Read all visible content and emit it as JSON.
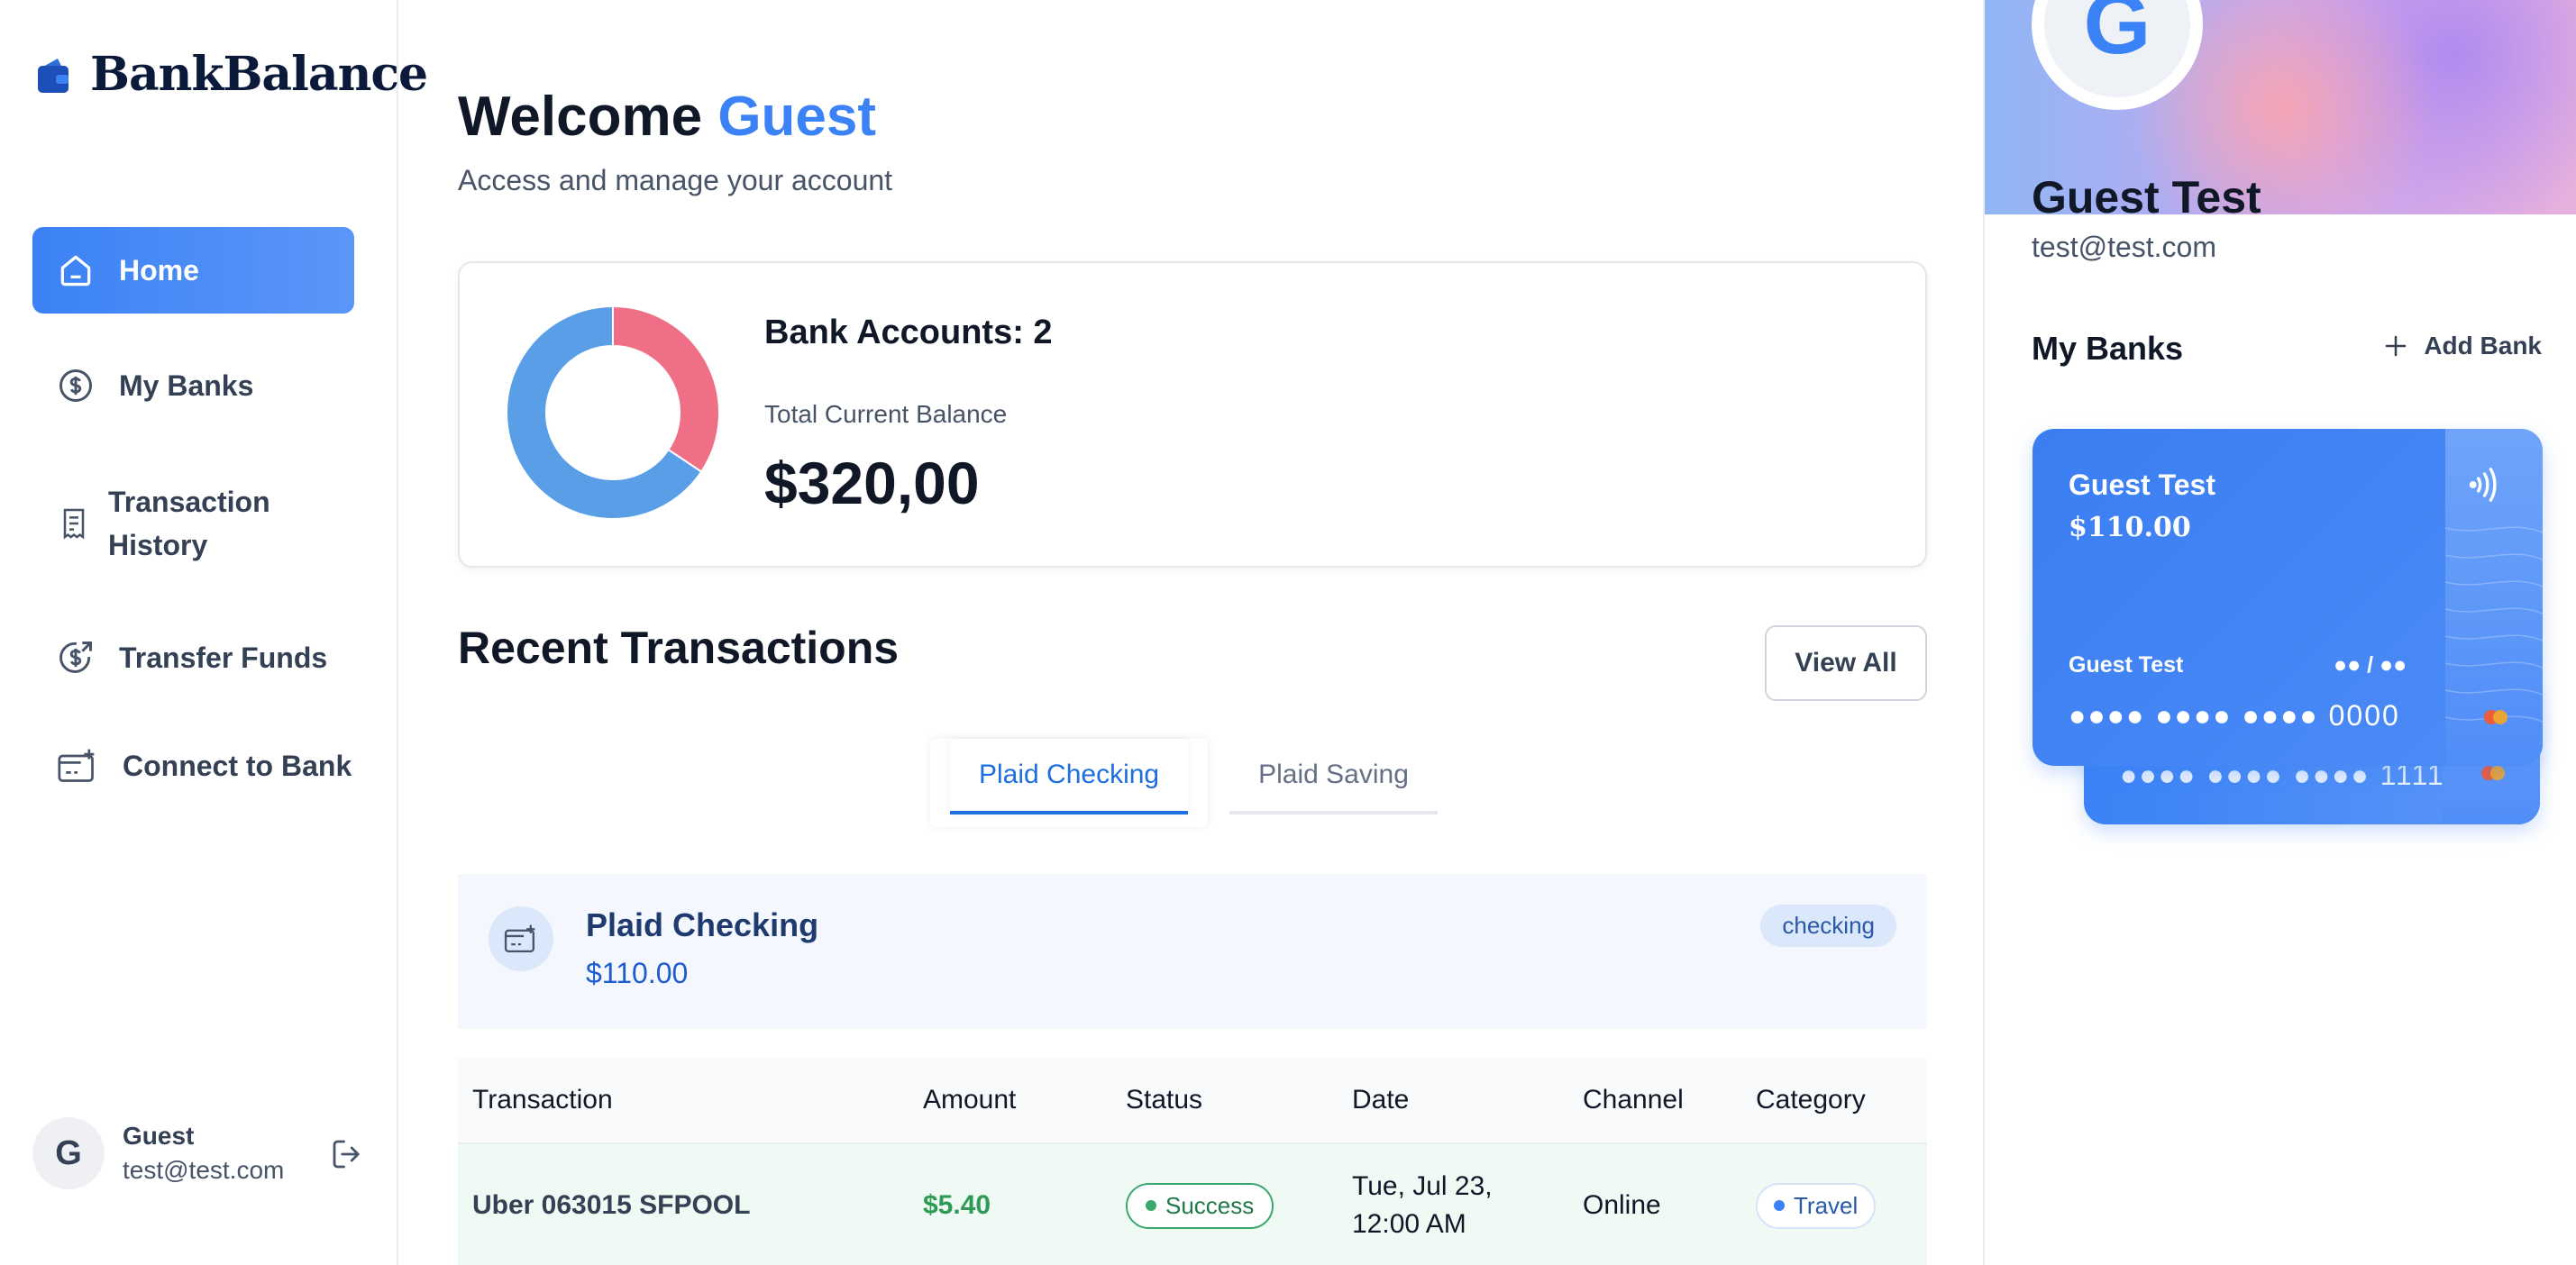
{
  "sidebar": {
    "logo_text": "BankBalance",
    "items": [
      {
        "label": "Home",
        "icon": "home-icon"
      },
      {
        "label": "My Banks",
        "icon": "dollar-circle-icon"
      },
      {
        "label": "Transaction",
        "label2": "History",
        "icon": "receipt-icon"
      },
      {
        "label": "Transfer Funds",
        "icon": "money-send-icon"
      },
      {
        "label": "Connect to Bank",
        "icon": "credit-card-add-icon"
      }
    ],
    "footer": {
      "initial": "G",
      "name": "Guest",
      "email": "test@test.com"
    }
  },
  "header": {
    "welcome_prefix": "Welcome",
    "welcome_name": "Guest",
    "subtitle": "Access and manage your account"
  },
  "summary": {
    "accounts_label": "Bank Accounts: 2",
    "balance_label": "Total Current Balance",
    "balance_value": "$320,00"
  },
  "chart_data": {
    "type": "pie",
    "values": [
      210,
      110
    ],
    "colors": [
      "#5a9ee8",
      "#ef6f86"
    ]
  },
  "recent": {
    "title": "Recent Transactions",
    "view_all": "View All",
    "tabs": [
      "Plaid Checking",
      "Plaid Saving"
    ],
    "active_tab": 0,
    "bank": {
      "name": "Plaid Checking",
      "balance": "$110.00",
      "type": "checking"
    },
    "columns": [
      "Transaction",
      "Amount",
      "Status",
      "Date",
      "Channel",
      "Category"
    ],
    "rows": [
      {
        "name": "Uber 063015 SFPOOL",
        "amount": "$5.40",
        "status": "Success",
        "date_line1": "Tue, Jul 23,",
        "date_line2": "12:00 AM",
        "channel": "Online",
        "category": "Travel"
      }
    ]
  },
  "profile": {
    "initial": "G",
    "name": "Guest Test",
    "email": "test@test.com",
    "my_banks_title": "My Banks",
    "add_bank": "Add Bank"
  },
  "cards": [
    {
      "name": "Guest Test",
      "balance": "$110.00",
      "holder": "Guest Test",
      "expiry": "●● / ●●",
      "number": "●●●● ●●●● ●●●● 0000"
    },
    {
      "number": "●●●● ●●●● ●●●● 1111"
    }
  ],
  "colors": {
    "accent": "#3b82f6",
    "success": "#2f9a55",
    "brand_dark": "#0b1a3a"
  }
}
